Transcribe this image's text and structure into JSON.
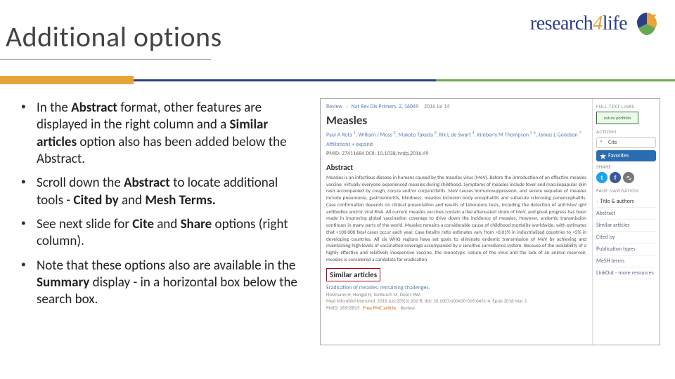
{
  "logo": {
    "part1": "research",
    "part2": "4",
    "part3": "life"
  },
  "title": "Additional options",
  "bullets": [
    {
      "html": "In the <b>Abstract</b> format, other features are displayed in the right column and a <b>Similar articles</b> option also has been added below the Abstract."
    },
    {
      "html": "Scroll down the <b>Abstract</b> to locate additional tools  -  <b>Cited by</b> and <b>Mesh Terms.</b>"
    },
    {
      "html": "See next slide for <b>Cite</b> and <b>Share</b> options (right column)."
    },
    {
      "html": "Note that these options also are available in the <b>Summary</b> display - in a horizontal box below the search box."
    }
  ],
  "screenshot": {
    "crumb": {
      "a": "Review",
      "b": "Nat Rev Dis Primers. 2, 16049",
      "c": "2016 Jul 14"
    },
    "article_title": "Measles",
    "authors_html": "Paul A Rota <sup>1</sup>, William J Moss <sup>2</sup>, Makoto Takeda <sup>3</sup>, Rik L de Swart <sup>4</sup>, Kimberly M Thompson <sup>5</sup> <sup>6</sup>, James L Goodson <sup>7</sup>",
    "affiliations": "Affiliations + expand",
    "ids": "PMID: 27411684   DOI: 10.1038/nrdp.2016.49",
    "abstract_heading": "Abstract",
    "abstract_body": "Measles is an infectious disease in humans caused by the measles virus (MeV). Before the introduction of an effective measles vaccine, virtually everyone experienced measles during childhood. Symptoms of measles include fever and maculopapular skin rash accompanied by cough, coryza and/or conjunctivitis. MeV causes immunosuppression, and severe sequelae of measles include pneumonia, gastroenteritis, blindness, measles inclusion body encephalitis and subacute sclerosing panencephalitis. Case confirmation depends on clinical presentation and results of laboratory tests, including the detection of anti-MeV IgM antibodies and/or viral RNA. All current measles vaccines contain a live attenuated strain of MeV, and great progress has been made in improving global vaccination coverage to drive down the incidence of measles. However, endemic transmission continues in many parts of the world. Measles remains a considerable cause of childhood mortality worldwide, with estimates that >100,000 fatal cases occur each year. Case fatality ratio estimates vary from <0.01% in industrialized countries to >5% in developing countries. All six WHO regions have set goals to eliminate endemic transmission of MeV by achieving and maintaining high levels of vaccination coverage accompanied by a sensitive surveillance system. Because of the availability of a highly effective and relatively inexpensive vaccine, the monotypic nature of the virus and the lack of an animal reservoir, measles is considered a candidate for eradication.",
    "similar_heading": "Similar articles",
    "similar_item": {
      "title": "Eradication of measles: remaining challenges.",
      "authors": "Holzmann H, Hengel H, Tenbusch M, Doerr HW.",
      "meta": "Med Microbiol Immunol. 2016 Jun;205(3):201-8. doi: 10.1007/s00430-016-0451-4. Epub 2016 Mar 2.",
      "pmid": "PMID: 26935825",
      "free": "Free PMC article.",
      "type": "Review."
    },
    "sidebar": {
      "full_text_links": "FULL TEXT LINKS",
      "ftl_badge": "nature portfolio",
      "actions": "ACTIONS",
      "cite": "Cite",
      "favorites": "Favorites",
      "share": "SHARE",
      "page_nav": "PAGE NAVIGATION",
      "nav": [
        "Title & authors",
        "Abstract",
        "Similar articles",
        "Cited by",
        "Publication types",
        "MeSH terms",
        "LinkOut - more resources"
      ]
    }
  }
}
